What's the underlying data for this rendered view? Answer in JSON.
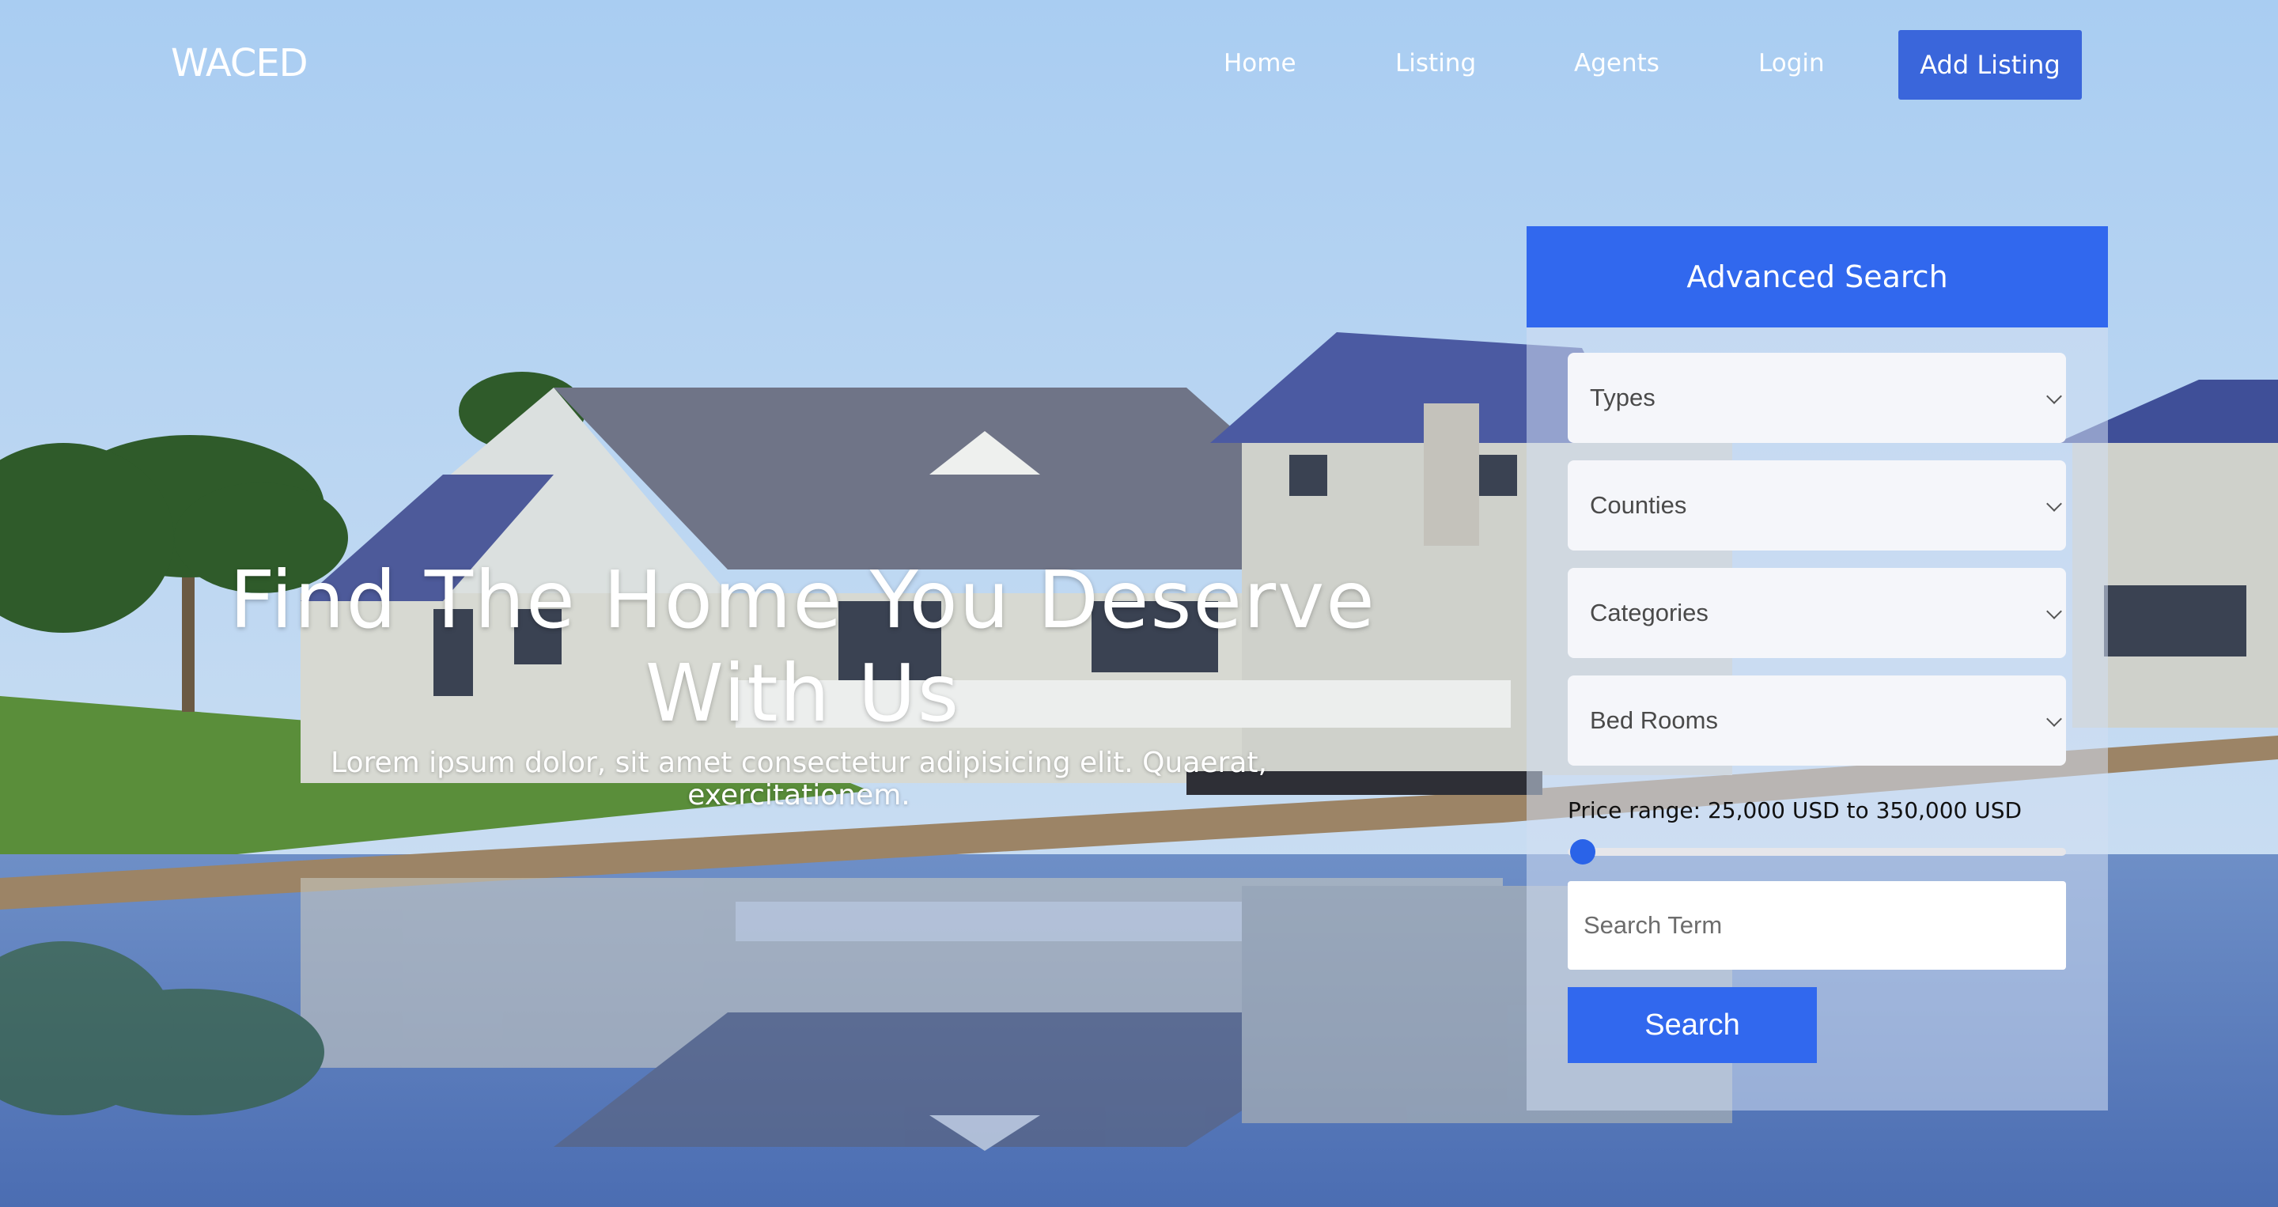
{
  "brand": {
    "logo": "WACED"
  },
  "nav": {
    "items": [
      {
        "label": "Home"
      },
      {
        "label": "Listing"
      },
      {
        "label": "Agents"
      },
      {
        "label": "Login"
      }
    ],
    "cta": "Add Listing"
  },
  "hero": {
    "title": "Find The Home You Deserve With Us",
    "subtitle": "Lorem ipsum dolor, sit amet consectetur adipisicing elit. Quaerat, exercitationem."
  },
  "search": {
    "heading": "Advanced Search",
    "selects": [
      {
        "selected": "Types"
      },
      {
        "selected": "Counties"
      },
      {
        "selected": "Categories"
      },
      {
        "selected": "Bed Rooms"
      }
    ],
    "price_label": "Price range: 25,000 USD to 350,000 USD",
    "price_slider_value": 0,
    "term_placeholder": "Search Term",
    "button": "Search"
  },
  "colors": {
    "accent": "#3168ee",
    "cta": "#3a66db",
    "sky": "#a8ccef",
    "water": "#4a6fb0"
  }
}
